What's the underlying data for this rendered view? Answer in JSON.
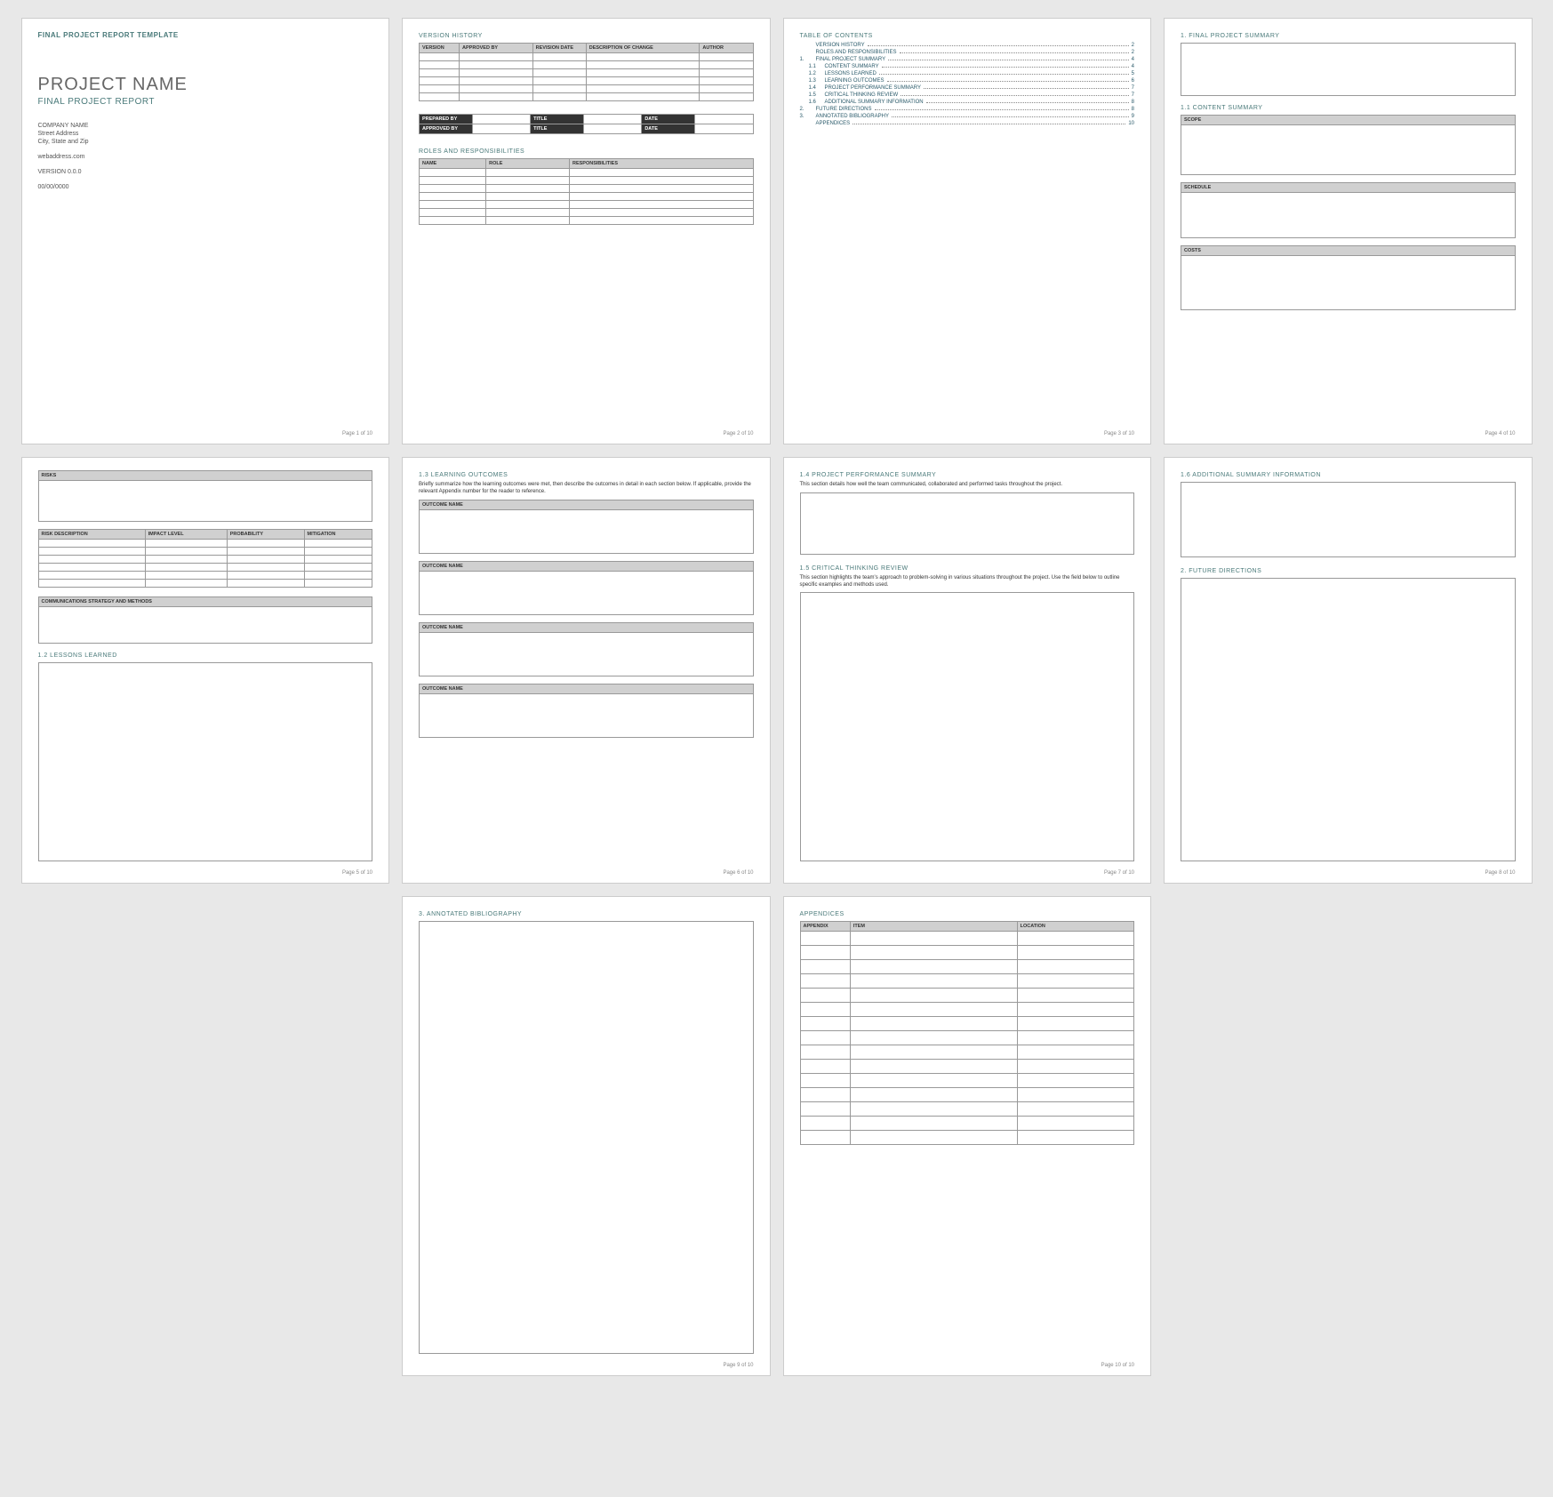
{
  "doc_header": "FINAL PROJECT REPORT TEMPLATE",
  "project_name": "PROJECT NAME",
  "subtitle": "FINAL PROJECT REPORT",
  "company": "COMPANY NAME",
  "street": "Street Address",
  "city": "City, State and Zip",
  "web": "webaddress.com",
  "version": "VERSION 0.0.0",
  "date": "00/00/0000",
  "footers": [
    "Page 1 of 10",
    "Page 2 of 10",
    "Page 3 of 10",
    "Page 4 of 10",
    "Page 5 of 10",
    "Page 6 of 10",
    "Page 7 of 10",
    "Page 8 of 10",
    "Page 9 of 10",
    "Page 10 of 10"
  ],
  "version_history": {
    "title": "VERSION HISTORY",
    "cols": [
      "VERSION",
      "APPROVED BY",
      "REVISION DATE",
      "DESCRIPTION OF CHANGE",
      "AUTHOR"
    ]
  },
  "signoff": {
    "prepared": "PREPARED BY",
    "approved": "APPROVED BY",
    "title": "TITLE",
    "date": "DATE"
  },
  "roles": {
    "title": "ROLES AND RESPONSIBILITIES",
    "cols": [
      "NAME",
      "ROLE",
      "RESPONSIBILITIES"
    ]
  },
  "toc": {
    "title": "TABLE OF CONTENTS",
    "items": [
      {
        "num": "",
        "label": "VERSION HISTORY",
        "pg": "2",
        "sub": false
      },
      {
        "num": "",
        "label": "ROLES AND RESPONSIBILITIES",
        "pg": "2",
        "sub": false
      },
      {
        "num": "1.",
        "label": "FINAL PROJECT SUMMARY",
        "pg": "4",
        "sub": false
      },
      {
        "num": "1.1",
        "label": "CONTENT SUMMARY",
        "pg": "4",
        "sub": true
      },
      {
        "num": "1.2",
        "label": "LESSONS LEARNED",
        "pg": "5",
        "sub": true
      },
      {
        "num": "1.3",
        "label": "LEARNING OUTCOMES",
        "pg": "6",
        "sub": true
      },
      {
        "num": "1.4",
        "label": "PROJECT PERFORMANCE SUMMARY",
        "pg": "7",
        "sub": true
      },
      {
        "num": "1.5",
        "label": "CRITICAL THINKING REVIEW",
        "pg": "7",
        "sub": true
      },
      {
        "num": "1.6",
        "label": "ADDITIONAL SUMMARY INFORMATION",
        "pg": "8",
        "sub": true
      },
      {
        "num": "2.",
        "label": "FUTURE DIRECTIONS",
        "pg": "8",
        "sub": false
      },
      {
        "num": "3.",
        "label": "ANNOTATED BIBLIOGRAPHY",
        "pg": "9",
        "sub": false
      },
      {
        "num": "",
        "label": "APPENDICES",
        "pg": "10",
        "sub": false
      }
    ]
  },
  "p4": {
    "h1": "1.  FINAL PROJECT SUMMARY",
    "h11": "1.1  CONTENT SUMMARY",
    "scope": "SCOPE",
    "schedule": "SCHEDULE",
    "costs": "COSTS"
  },
  "p5": {
    "risks": "RISKS",
    "risk_cols": [
      "RISK DESCRIPTION",
      "IMPACT LEVEL",
      "PROBABILITY",
      "MITIGATION"
    ],
    "comms": "COMMUNICATIONS STRATEGY AND METHODS",
    "h12": "1.2  LESSONS LEARNED"
  },
  "p6": {
    "h13": "1.3  LEARNING OUTCOMES",
    "desc": "Briefly summarize how the learning outcomes were met, then describe the outcomes in detail in each section below. If applicable, provide the relevant Appendix number for the reader to reference.",
    "outcome": "OUTCOME NAME"
  },
  "p7": {
    "h14": "1.4  PROJECT PERFORMANCE SUMMARY",
    "d14": "This section details how well the team communicated, collaborated and performed tasks throughout the project.",
    "h15": "1.5  CRITICAL THINKING REVIEW",
    "d15": "This section highlights the team's approach to problem-solving in various situations throughout the project. Use the field below to outline specific examples and methods used."
  },
  "p8": {
    "h16": "1.6  ADDITIONAL SUMMARY INFORMATION",
    "h2": "2.  FUTURE DIRECTIONS"
  },
  "p9": {
    "h3": "3.  ANNOTATED BIBLIOGRAPHY"
  },
  "p10": {
    "title": "APPENDICES",
    "cols": [
      "APPENDIX",
      "ITEM",
      "LOCATION"
    ]
  }
}
